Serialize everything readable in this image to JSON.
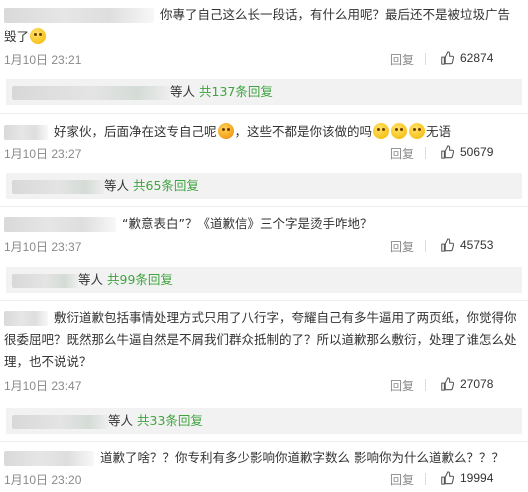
{
  "comments": [
    {
      "text": "你專了自己这么长一段话，有什么用呢？最后还不是被垃圾广告毁了",
      "date": "1月10日 23:21",
      "reply_label": "回复",
      "likes": "62874",
      "sub_suffix": "等人",
      "sub_total": "共137条回复"
    },
    {
      "text_a": "好家伙，后面净在这专自己呢",
      "text_b": "，这些不都是你该做的吗",
      "text_c": "无语",
      "date": "1月10日 23:27",
      "reply_label": "回复",
      "likes": "50679",
      "sub_suffix": "等人",
      "sub_total": "共65条回复"
    },
    {
      "text": "“歉意表白”？《道歉信》三个字是烫手咋地？",
      "date": "1月10日 23:37",
      "reply_label": "回复",
      "likes": "45753",
      "sub_suffix": "等人",
      "sub_total": "共99条回复"
    },
    {
      "text": "敷衍道歉包括事情处理方式只用了八行字，夸耀自己有多牛逼用了两页纸，你觉得你很委屈吧？既然那么牛逼自然是不屑我们群众抵制的了？所以道歉那么敷衍，处理了谁怎么处理，也不说说？",
      "date": "1月10日 23:47",
      "reply_label": "回复",
      "likes": "27078",
      "sub_suffix": "等人",
      "sub_total": "共33条回复"
    },
    {
      "text": "道歉了啥？？你专利有多少影响你道歉字数么 影响你为什么道歉么？？？",
      "date": "1月10日 23:20",
      "reply_label": "回复",
      "likes": "19994"
    }
  ],
  "icons": {
    "like": "thumbs-up-icon",
    "emoji": "emoji-icon"
  },
  "colors": {
    "reply_count": "#3fa33f",
    "sub_bg": "#f2f2f2",
    "meta": "#8a8a8a"
  }
}
